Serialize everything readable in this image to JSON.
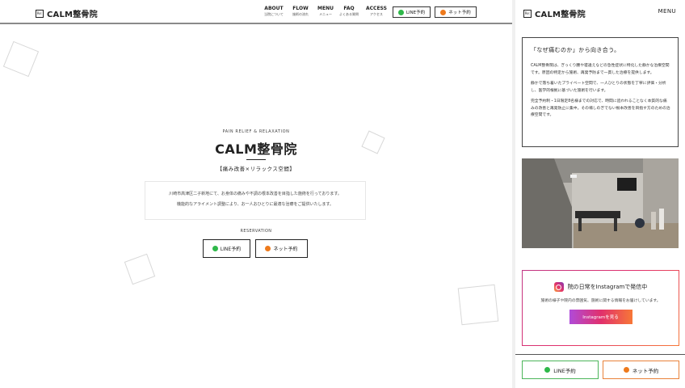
{
  "brand": {
    "mark": "Re:",
    "name": "CALM整骨院"
  },
  "nav": [
    {
      "en": "ABOUT",
      "jp": "当院について"
    },
    {
      "en": "FLOW",
      "jp": "施術の流れ"
    },
    {
      "en": "MENU",
      "jp": "メニュー"
    },
    {
      "en": "FAQ",
      "jp": "よくある質問"
    },
    {
      "en": "ACCESS",
      "jp": "アクセス"
    }
  ],
  "header_buttons": {
    "line": "LINE予約",
    "net": "ネット予約"
  },
  "hero": {
    "subtitle": "PAIN RELIEF & RELAXATION",
    "title": "CALM整骨院",
    "tagline": "【痛み改善×リラックス空間】",
    "intro": [
      "川崎市高津区二子新地にて、お身体の痛みや不調の根本改善を目指した施術を行っております。",
      "機能的なアライメント調整により、お一人おひとりに最適な治療をご提供いたします。"
    ],
    "reservation_label": "RESERVATION",
    "line_button": "LINE予約",
    "net_button": "ネット予約"
  },
  "panel": {
    "menu_label": "MENU",
    "card": {
      "heading": "「なぜ痛むのか」から向き合う。",
      "paragraphs": [
        "CALM整骨院は、ぎっくり腰や寝違えなどの急性症状に特化した静かな治療空間です。原因の特定から施術、再発予防まで一貫した治療を提供します。",
        "静かで落ち着いたプライベート空間で、一人ひとりの状態を丁寧に評価・分析し、医学的根拠に基づいた施術を行います。",
        "完全予約制・1日限定8名様までの対応で、時間に追われることなく本質的な痛みの改善と再発防止に集中。その場しのぎでない根本改善を目指す方のための治療空間です。"
      ]
    },
    "instagram": {
      "title": "院の日常をInstagramで発信中",
      "description": "施術の様子や院内の雰囲気、施術に関する情報をお届けしています。",
      "button": "Instagramを見る"
    },
    "footer_buttons": {
      "line": "LINE予約",
      "net": "ネット予約"
    }
  },
  "colors": {
    "line_green": "#2fb84a",
    "net_orange": "#ee7a1d",
    "line_border": "#4cb55a",
    "net_border": "#e9823a"
  },
  "icons": [
    "line-icon",
    "check-icon",
    "instagram-icon"
  ]
}
